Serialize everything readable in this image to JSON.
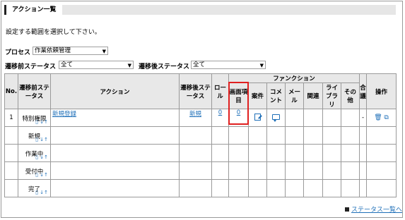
{
  "page": {
    "title": "アクション一覧",
    "instruction": "設定する範囲を選択して下さい。"
  },
  "filters": {
    "process_label": "プロセス",
    "process_value": "作業依頼管理",
    "before_label": "遷移前ステータス",
    "before_value": "全て",
    "after_label": "遷移後ステータス",
    "after_value": "全て"
  },
  "table": {
    "headers": {
      "no": "No.",
      "before_status": "遷移前ステータス",
      "action": "アクション",
      "after_status": "遷移後ステータス",
      "role": "ロール",
      "function_group": "ファンクション",
      "screen_item": "画面項目",
      "case": "案件",
      "comment": "コメント",
      "mail": "メール",
      "related": "関連",
      "library": "ライブラリ",
      "other": "その他",
      "consult": "合議",
      "operation": "操作"
    },
    "rows": [
      {
        "no": "1",
        "before_status": "特別権限",
        "action": "新規登録",
        "after_status": "新規",
        "role": "0",
        "screen_item": "0",
        "consult": "-"
      },
      {
        "no": "",
        "before_status": "新規"
      },
      {
        "no": "",
        "before_status": "作業中"
      },
      {
        "no": "",
        "before_status": "受付中"
      },
      {
        "no": "",
        "before_status": "完了"
      }
    ]
  },
  "footer": {
    "status_list_link": "ステータス一覧へ"
  },
  "icons": {
    "status_doc": "document-icon",
    "status_sort": "sort-icon",
    "edit": "edit-icon",
    "comment": "comment-icon",
    "delete": "trash-icon",
    "copy": "copy-icon"
  },
  "colors": {
    "link": "#1e6fb8",
    "highlight": "#e02020",
    "header_bg": "#e8e8e8"
  }
}
